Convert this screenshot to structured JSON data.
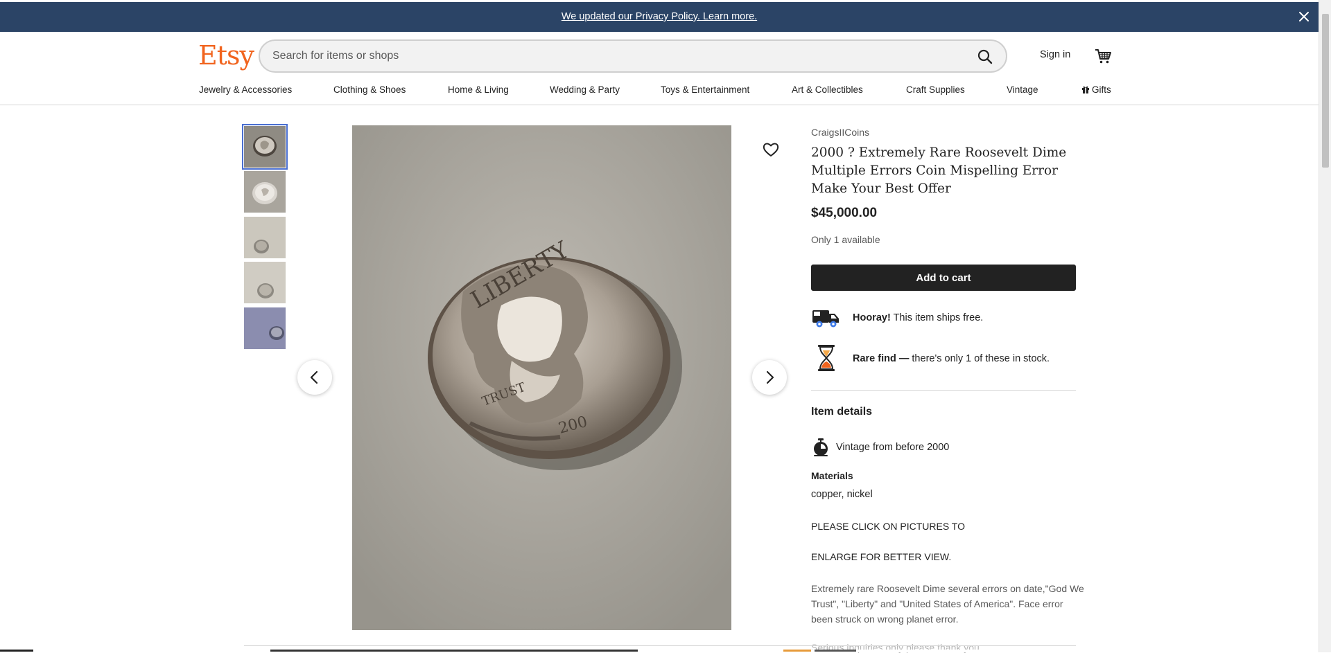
{
  "notice": {
    "text": "We updated our Privacy Policy. Learn more.",
    "close_icon": "close-icon"
  },
  "header": {
    "logo": "Etsy",
    "search_placeholder": "Search for items or shops",
    "sign_in": "Sign in",
    "icons": [
      "search-icon",
      "cart-icon"
    ]
  },
  "categories": [
    "Jewelry & Accessories",
    "Clothing & Shoes",
    "Home & Living",
    "Wedding & Party",
    "Toys & Entertainment",
    "Art & Collectibles",
    "Craft Supplies",
    "Vintage",
    "Gifts"
  ],
  "gallery": {
    "thumbnail_count": 5,
    "active_index": 0
  },
  "listing": {
    "shop_name": "CraigsIICoins",
    "title": "2000 ? Extremely Rare Roosevelt Dime Multiple Errors Coin Mispelling Error Make Your Best Offer",
    "price": "$45,000.00",
    "availability": "Only 1 available",
    "add_to_cart": "Add to cart",
    "perks": [
      {
        "strong": "Hooray!",
        "text": " This item ships free.",
        "icon": "truck-icon"
      },
      {
        "strong": "Rare find — ",
        "text": "there's only 1 of these in stock.",
        "icon": "hourglass-icon"
      }
    ]
  },
  "details": {
    "heading": "Item details",
    "vintage": "Vintage from before 2000",
    "materials_label": "Materials",
    "materials": "copper, nickel",
    "description": [
      "PLEASE CLICK ON PICTURES TO",
      "ENLARGE FOR BETTER VIEW.",
      "Extremely rare Roosevelt Dime several errors on date,\"God We Trust\", \"Liberty\" and \"United States of America\". Face error been struck on wrong planet error.",
      "Serious inquiries only please thank you"
    ]
  },
  "colors": {
    "brand": "#f1641e",
    "notice_bg": "#2b4466",
    "button_bg": "#222222",
    "thumb_selected": "#4a6fd1"
  }
}
